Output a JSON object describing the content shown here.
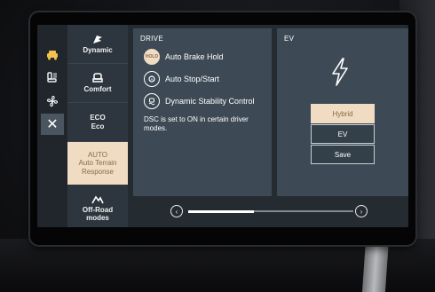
{
  "drive_panel": {
    "title": "DRIVE",
    "options": [
      {
        "label": "Auto Brake Hold",
        "icon": "hold-icon",
        "icon_text": "HOLD",
        "active": true
      },
      {
        "label": "Auto Stop/Start",
        "icon": "stop-start-icon",
        "active": false
      },
      {
        "label": "Dynamic Stability Control",
        "icon": "stability-control-icon",
        "active": false
      }
    ],
    "note": "DSC is set to ON in certain driver modes."
  },
  "ev_panel": {
    "title": "EV",
    "icon": "lightning-bolt-icon",
    "buttons": [
      {
        "label": "Hybrid",
        "selected": true
      },
      {
        "label": "EV",
        "selected": false
      },
      {
        "label": "Save",
        "selected": false
      }
    ]
  },
  "modes": [
    {
      "label": "Dynamic",
      "icon": "dynamic-flag-icon",
      "selected": false
    },
    {
      "label": "Comfort",
      "icon": "seat-icon",
      "selected": false
    },
    {
      "label": "ECO",
      "sub": "Eco",
      "selected": false
    },
    {
      "label": "AUTO",
      "sub": "Auto Terrain Response",
      "selected": true
    },
    {
      "label": "Off-Road modes",
      "icon": "mountain-icon",
      "selected": false
    }
  ],
  "rail": [
    {
      "icon": "vehicle-icon"
    },
    {
      "icon": "seat-heat-icon"
    },
    {
      "icon": "fan-icon"
    },
    {
      "icon": "close-icon",
      "glyph": "✕"
    }
  ],
  "scroller": {
    "position": 0.4
  },
  "colors": {
    "accent": "#f0dcc2",
    "panel": "#3d4a55",
    "screen": "#242b31"
  }
}
